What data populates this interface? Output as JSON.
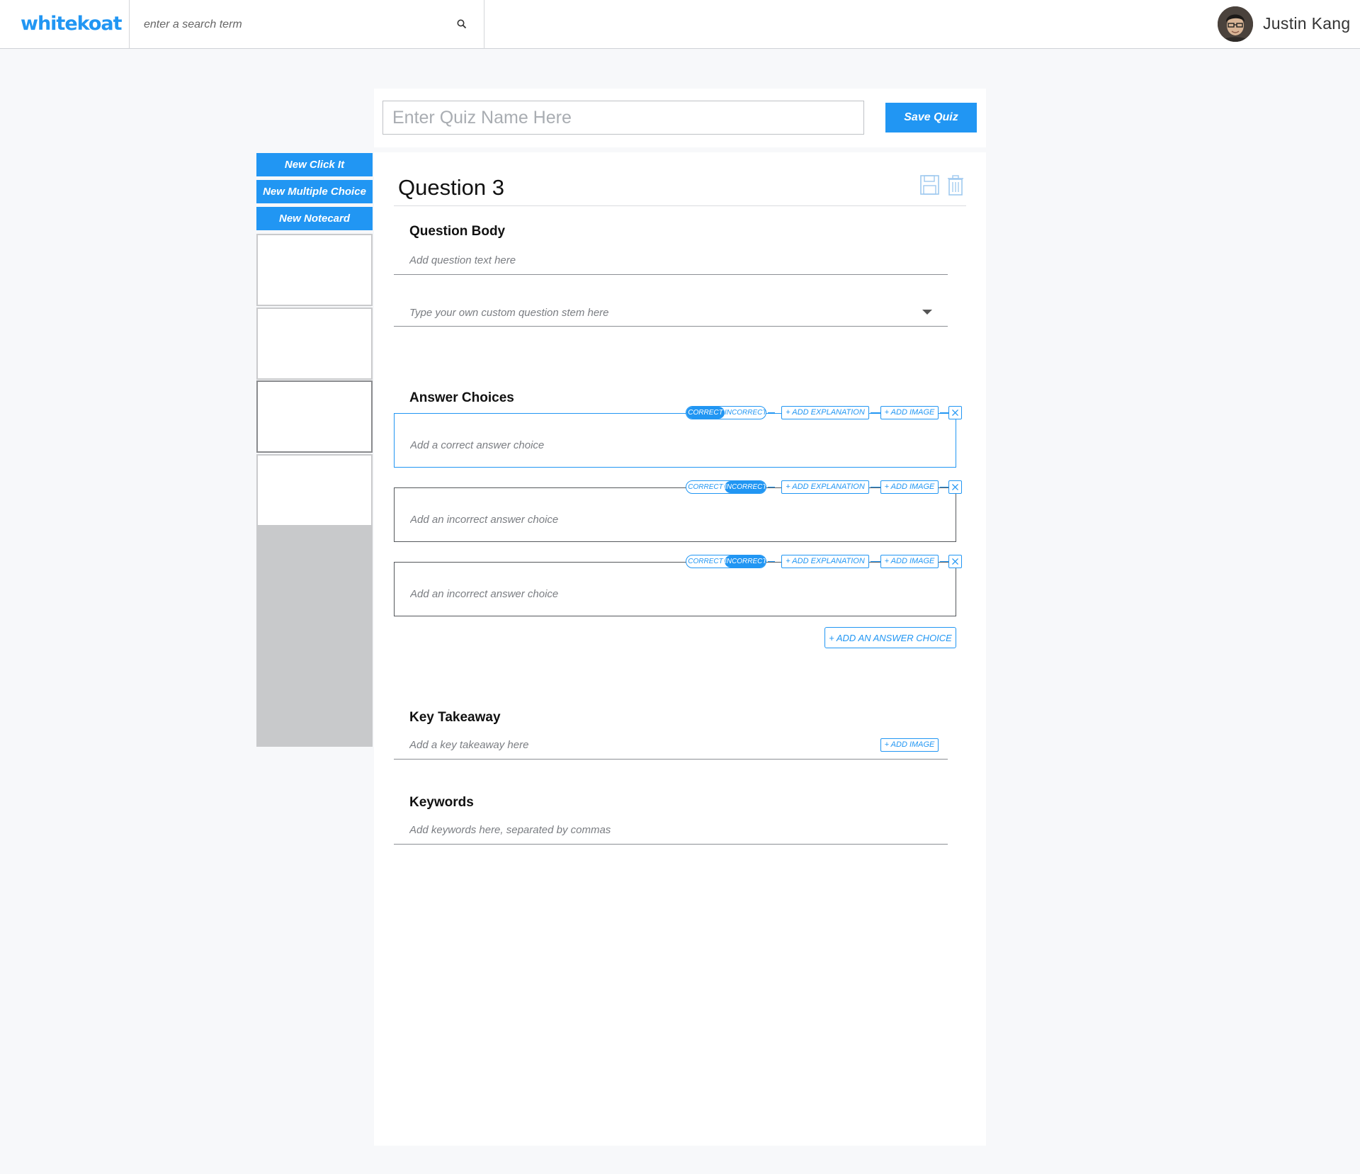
{
  "header": {
    "logo": "whitekoat",
    "search_placeholder": "enter a search term",
    "user_name": "Justin Kang"
  },
  "sidebar": {
    "buttons": [
      "New Click It",
      "New Multiple Choice",
      "New Notecard"
    ],
    "thumbnails": 4,
    "active_thumbnail": 3
  },
  "quiz": {
    "name_placeholder": "Enter Quiz Name Here",
    "save_label": "Save Quiz"
  },
  "question": {
    "title": "Question 3",
    "body_heading": "Question Body",
    "body_placeholder": "Add question text here",
    "stem_placeholder": "Type your own custom question stem here",
    "answers_heading": "Answer Choices",
    "correct_label": "CORRECT",
    "incorrect_label": "INCORRECT",
    "add_explanation_label": "+ ADD EXPLANATION",
    "add_image_label": "+ ADD IMAGE",
    "answers": [
      {
        "placeholder": "Add a correct answer choice",
        "state": "correct"
      },
      {
        "placeholder": "Add an incorrect answer choice",
        "state": "incorrect"
      },
      {
        "placeholder": "Add an incorrect answer choice",
        "state": "incorrect"
      }
    ],
    "add_answer_label": "+ ADD AN ANSWER CHOICE",
    "takeaway_heading": "Key Takeaway",
    "takeaway_placeholder": "Add a key takeaway here",
    "keywords_heading": "Keywords",
    "keywords_placeholder": "Add keywords here, separated by commas"
  },
  "icons": {
    "search": "search-icon",
    "save": "save-icon",
    "delete": "trash-icon",
    "remove": "close-icon",
    "dropdown": "caret-down-icon"
  },
  "colors": {
    "accent": "#2196f3",
    "thumb_area": "#c8c9cb"
  }
}
